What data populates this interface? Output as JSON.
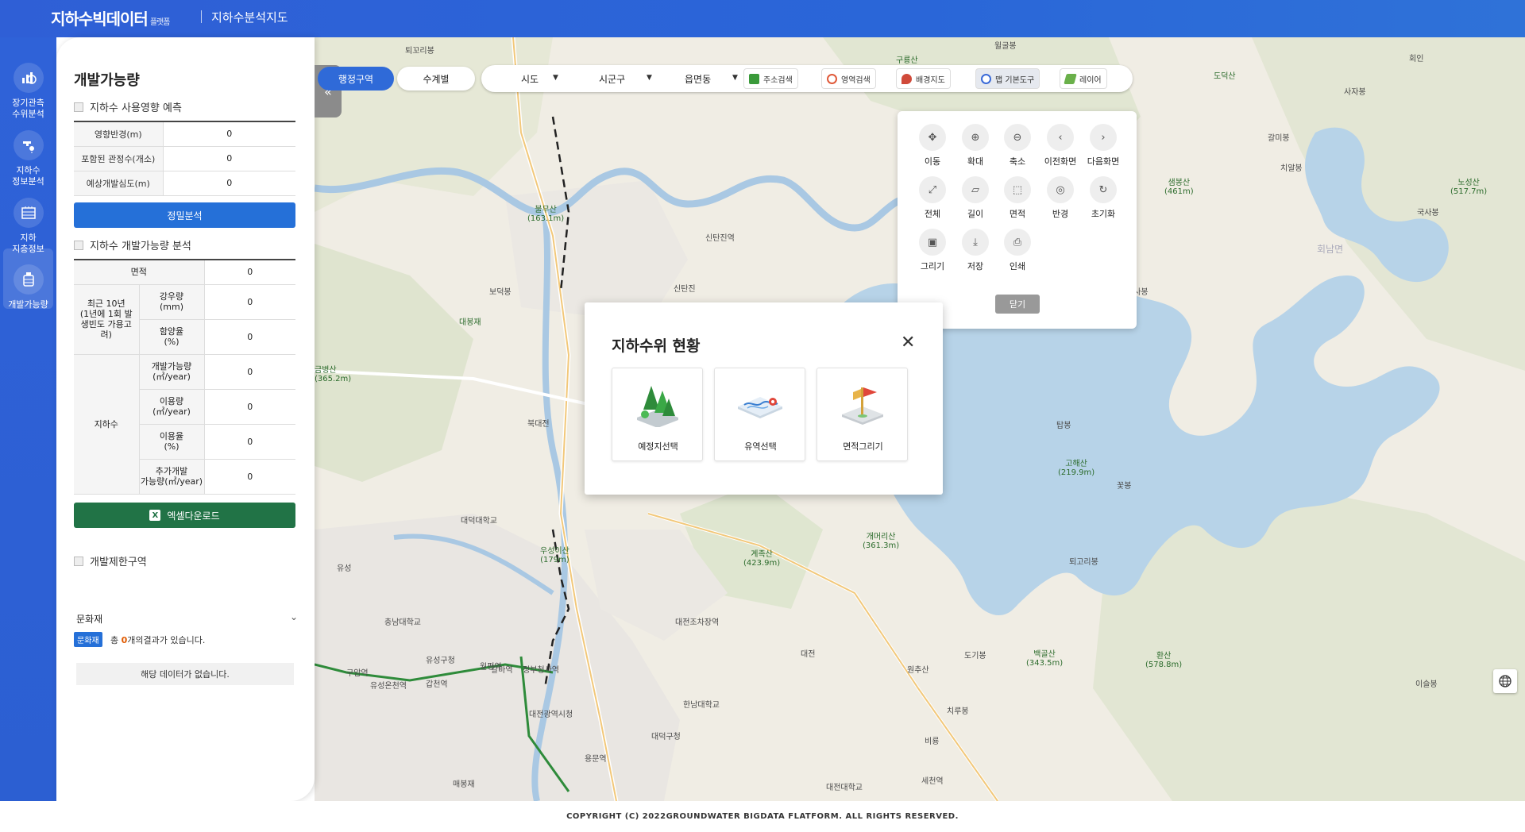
{
  "header": {
    "logo": "지하수빅데이터",
    "logo_sub": "플랫폼",
    "title": "지하수분석지도"
  },
  "rail": [
    {
      "label": "장기관측\n수위분석",
      "icon": "chart-icon"
    },
    {
      "label": "지하수\n정보분석",
      "icon": "water-tap-icon"
    },
    {
      "label": "지하\n지층정보",
      "icon": "layers-icon"
    },
    {
      "label": "개발가능량",
      "icon": "tank-icon",
      "active": true
    }
  ],
  "panel": {
    "title": "개발가능량",
    "section1": "지하수 사용영향 예측",
    "predict_rows": [
      {
        "label": "영향반경(m)",
        "value": "0"
      },
      {
        "label": "포함된 관정수(개소)",
        "value": "0"
      },
      {
        "label": "예상개발심도(m)",
        "value": "0"
      }
    ],
    "analyze_btn": "정밀분석",
    "section2": "지하수 개발가능량 분석",
    "area_label": "면적",
    "area_value": "0",
    "rain_group": "최근 10년\n(1년에 1회 발\n생빈도 가용고\n려)",
    "rain_rows": [
      {
        "label": "강우량\n(mm)",
        "value": "0"
      },
      {
        "label": "함양율\n(%)",
        "value": "0"
      }
    ],
    "gw_group": "지하수",
    "gw_rows": [
      {
        "label": "개발가능량\n(㎥/year)",
        "value": "0"
      },
      {
        "label": "이용량\n(㎥/year)",
        "value": "0"
      },
      {
        "label": "이용율\n(%)",
        "value": "0"
      },
      {
        "label": "추가개발\n가능량(㎥/year)",
        "value": "0"
      }
    ],
    "excel_btn": "엑셀다운로드",
    "section3": "개발제한구역",
    "category": "문화재",
    "badge": "문화재",
    "result_prefix": "총",
    "result_count": "0",
    "result_suffix": "개의결과가 있습니다.",
    "nodata": "해당 데이터가 없습니다."
  },
  "topbar": {
    "tab_admin": "행정구역",
    "tab_basin": "수계별",
    "sido": "시도",
    "sigungu": "시군구",
    "eupmyeon": "읍면동",
    "tools": [
      {
        "label": "주소검색",
        "icon": "map-search-icon",
        "color": "#3a9a3a"
      },
      {
        "label": "영역검색",
        "icon": "area-search-icon",
        "color": "#e05a3a"
      },
      {
        "label": "배경지도",
        "icon": "background-map-icon",
        "color": "#d04a3a"
      },
      {
        "label": "맵 기본도구",
        "icon": "map-tools-icon",
        "color": "#3a6ad8",
        "active": true
      },
      {
        "label": "레이어",
        "icon": "layer-icon",
        "color": "#6ab04a"
      }
    ]
  },
  "maptools": {
    "items": [
      {
        "label": "이동",
        "icon": "move-icon",
        "glyph": "✥"
      },
      {
        "label": "확대",
        "icon": "zoom-in-icon",
        "glyph": "⊕"
      },
      {
        "label": "축소",
        "icon": "zoom-out-icon",
        "glyph": "⊖"
      },
      {
        "label": "이전화면",
        "icon": "prev-icon",
        "glyph": "‹"
      },
      {
        "label": "다음화면",
        "icon": "next-icon",
        "glyph": "›"
      },
      {
        "label": "전체",
        "icon": "fullscreen-icon",
        "glyph": "⤢"
      },
      {
        "label": "길이",
        "icon": "ruler-icon",
        "glyph": "▱"
      },
      {
        "label": "면적",
        "icon": "area-icon",
        "glyph": "⬚"
      },
      {
        "label": "반경",
        "icon": "radius-icon",
        "glyph": "◎"
      },
      {
        "label": "초기화",
        "icon": "reset-icon",
        "glyph": "↻"
      },
      {
        "label": "그리기",
        "icon": "draw-icon",
        "glyph": "▣"
      },
      {
        "label": "저장",
        "icon": "save-icon",
        "glyph": "⤓"
      },
      {
        "label": "인쇄",
        "icon": "print-icon",
        "glyph": "⎙"
      }
    ],
    "close": "닫기"
  },
  "modal": {
    "title": "지하수위 현황",
    "cards": [
      {
        "label": "예정지선택",
        "icon": "forest-site-icon"
      },
      {
        "label": "유역선택",
        "icon": "basin-map-icon"
      },
      {
        "label": "면적그리기",
        "icon": "area-flag-icon"
      }
    ]
  },
  "map_labels": [
    "퇴꼬리봉",
    "윌굴봉",
    "구룡산",
    "도덕산",
    "회인",
    "사자봉",
    "갈미봉",
    "치알봉",
    "샘봉산\n(461m)",
    "노성산\n(517.7m)",
    "국사봉",
    "회남면",
    "불무산\n(163.1m)",
    "신탄진역",
    "보덕봉",
    "대봉재",
    "신탄진",
    "금병산\n(365.2m)",
    "북대전",
    "탑봉",
    "고해산\n(219.9m)",
    "국사봉",
    "꽃봉",
    "대덕대학교",
    "우성이산\n(179m)",
    "계족산\n(423.9m)",
    "개머리산\n(361.3m)",
    "퇴고리봉",
    "충남대학교",
    "유성",
    "대전조차장역",
    "대전",
    "원추산",
    "도기봉",
    "백골산\n(343.5m)",
    "환산\n(578.8m)",
    "이슬봉",
    "대전광역시청",
    "한남대학교",
    "대덕구청",
    "유성구청",
    "대전대학교",
    "비룡",
    "치루봉",
    "세천역",
    "매봉재",
    "용문역",
    "갑천역",
    "월평역",
    "구암역",
    "유성온천역",
    "정부청사역",
    "갈마역"
  ],
  "footer": "COPYRIGHT (C) 2022GROUNDWATER BIGDATA FLATFORM. ALL RIGHTS RESERVED."
}
